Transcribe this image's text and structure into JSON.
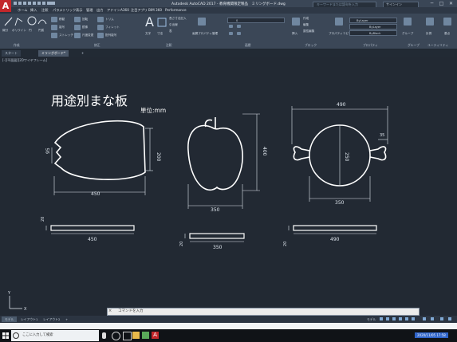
{
  "app": {
    "title": "Autodesk AutoCAD 2017 - 教育機関限定製品　ミリングボード.dwg",
    "logo_letter": "A",
    "performance": "Performance"
  },
  "search": {
    "placeholder": "キーワードまたは語句を入力"
  },
  "signin": {
    "label": "サインイン"
  },
  "menu": [
    "ホーム",
    "挿入",
    "注釈",
    "パラメトリック",
    "表示",
    "管理",
    "出力",
    "アドイン",
    "A360",
    "注目アプリ",
    "BIM 360",
    "Performance"
  ],
  "ribbon": {
    "panels": [
      "作成",
      "修正",
      "注釈",
      "画層",
      "ブロック",
      "プロパティ",
      "グループ",
      "ユーティリティ"
    ],
    "tools": {
      "line": "線分",
      "polyline": "ポリライン",
      "circle": "円",
      "arc": "円弧",
      "move": "移動",
      "rotate": "回転",
      "trim": "トリム",
      "copy": "複写",
      "mirror": "鏡像",
      "fillet": "フィレット",
      "stretch": "ストレッチ",
      "scale": "尺度変更",
      "array": "配列複写",
      "text": "文字",
      "dimension": "寸法",
      "table": "表",
      "layer_props": "画層プロパティ管理",
      "insert": "挿入",
      "create": "作成",
      "edit": "編集",
      "edit_attr": "属性編集",
      "match": "プロパティコピー",
      "group": "グループ",
      "measure": "計測",
      "base": "基点",
      "bylayer1": "ByLayer",
      "bylayer2": "ByLayer",
      "bylayer3": "ByBlock"
    },
    "linear_dim": "長さ寸法記入",
    "leader": "引出線",
    "current_layer": "0"
  },
  "doc_tabs": [
    "スタート",
    "ミリングボード*"
  ],
  "viewport_label": "[-][平面図][2Dワイヤフレーム]",
  "drawing": {
    "title": "用途別まな板",
    "unit": "単位:mm",
    "fish": {
      "width": "450",
      "height": "200",
      "notch": "95",
      "plate_width": "450",
      "thickness": "20"
    },
    "apple": {
      "width": "350",
      "height": "400",
      "plate_width": "350",
      "thickness": "20"
    },
    "round": {
      "overall": "490",
      "diameter": "350",
      "circle": "250",
      "handle": "35",
      "plate_width": "490",
      "thickness": "20"
    }
  },
  "cmd": {
    "x": "×",
    "prompt": "コマンドを入力"
  },
  "layout_tabs": [
    "モデル",
    "レイアウト1",
    "レイアウト2",
    "+"
  ],
  "status": {
    "model": "モデル"
  },
  "taskbar": {
    "search": "ここに入力して検索",
    "time": "2020/11/05 17:58"
  }
}
